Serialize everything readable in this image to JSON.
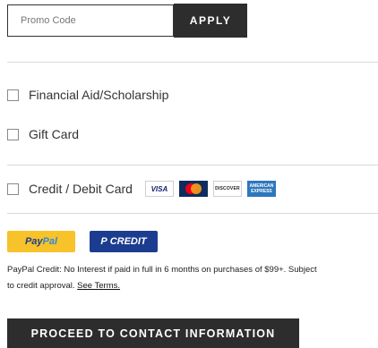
{
  "promo": {
    "placeholder": "Promo Code",
    "value": "",
    "apply_label": "APPLY"
  },
  "payment_options": [
    {
      "label": "Financial Aid/Scholarship",
      "checked": false
    },
    {
      "label": "Gift Card",
      "checked": false
    },
    {
      "label": "Credit / Debit Card",
      "checked": false
    }
  ],
  "card_logos": [
    {
      "name": "visa-logo",
      "text": "VISA",
      "color": "#1a1f71"
    },
    {
      "name": "mastercard-logo",
      "text": "",
      "color": "#0e2c5e"
    },
    {
      "name": "discover-logo",
      "text": "DISCOVER",
      "color": "#222222"
    },
    {
      "name": "amex-logo",
      "text": "AMERICAN EXPRESS",
      "color": "#2e77bc"
    }
  ],
  "paypal": {
    "paypal_part1": "Pay",
    "paypal_part2": "Pal",
    "credit_p": "P",
    "credit_label": "CREDIT"
  },
  "disclaimer": {
    "line1": "PayPal Credit: No Interest if paid in full in 6 months on purchases of $99+. Subject",
    "line2": "to credit approval.",
    "link": "See Terms."
  },
  "proceed_label": "PROCEED TO CONTACT INFORMATION",
  "colors": {
    "dark_button": "#2d2d2d",
    "paypal_yellow": "#f7c22a",
    "paypal_credit_blue": "#1c3c8f"
  }
}
